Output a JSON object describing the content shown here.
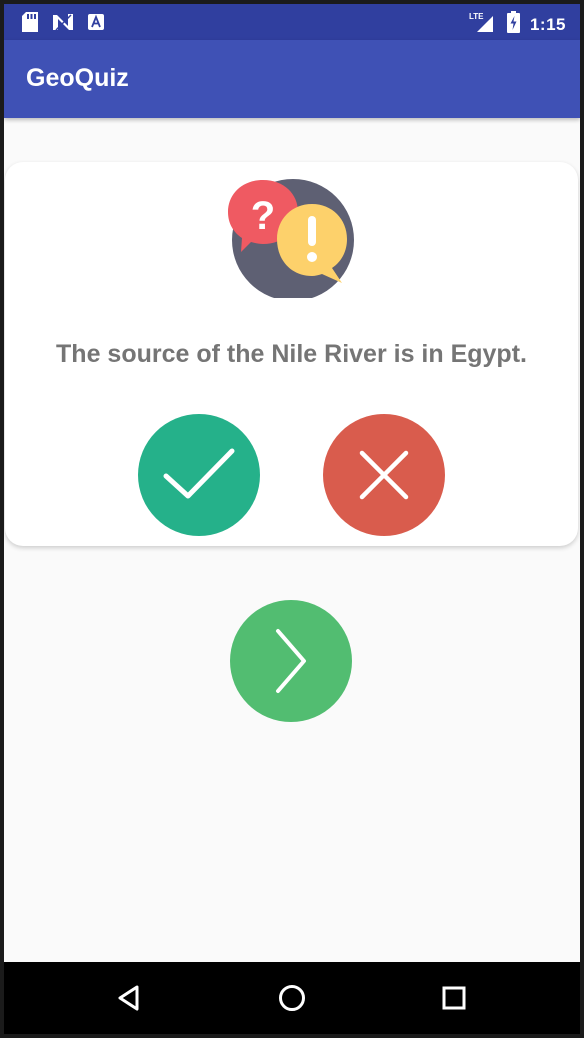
{
  "status_bar": {
    "time": "1:15",
    "network_label": "LTE",
    "icons": [
      "sd-card-icon",
      "n-notification-icon",
      "a-notification-icon",
      "lte-signal-icon",
      "battery-charging-icon"
    ]
  },
  "app_bar": {
    "title": "GeoQuiz"
  },
  "question": {
    "text": "The source of the Nile River is in Egypt.",
    "icon": "question-exclamation-bubbles-icon"
  },
  "answers": {
    "true_icon": "checkmark-icon",
    "false_icon": "x-icon"
  },
  "next": {
    "icon": "chevron-right-icon"
  },
  "nav_bar": {
    "icons": [
      "back-triangle-icon",
      "home-circle-icon",
      "recents-square-icon"
    ]
  },
  "colors": {
    "status_bar": "#303f9f",
    "app_bar": "#3f51b5",
    "true_button": "#25b18a",
    "false_button": "#d95c4d",
    "next_button": "#52bd71",
    "question_text": "#757575"
  }
}
